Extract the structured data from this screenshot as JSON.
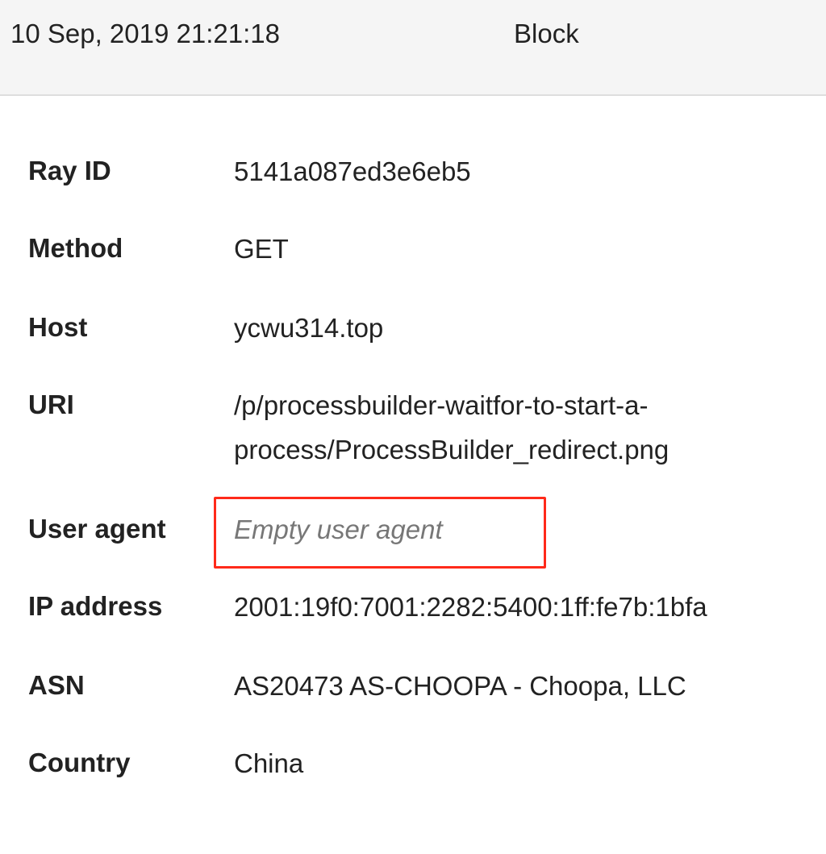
{
  "header": {
    "timestamp": "10 Sep, 2019 21:21:18",
    "action": "Block"
  },
  "details": [
    {
      "label": "Ray ID",
      "value": "5141a087ed3e6eb5"
    },
    {
      "label": "Method",
      "value": "GET"
    },
    {
      "label": "Host",
      "value": "ycwu314.top"
    },
    {
      "label": "URI",
      "value": "/p/processbuilder-waitfor-to-start-a-process/ProcessBuilder_redirect.png"
    },
    {
      "label": "User agent",
      "value": "Empty user agent"
    },
    {
      "label": "IP address",
      "value": "2001:19f0:7001:2282:5400:1ff:fe7b:1bfa"
    },
    {
      "label": "ASN",
      "value": "AS20473 AS-CHOOPA - Choopa, LLC"
    },
    {
      "label": "Country",
      "value": "China"
    }
  ],
  "colors": {
    "highlight": "#ff2a1a",
    "header_bg": "#f5f5f5"
  }
}
